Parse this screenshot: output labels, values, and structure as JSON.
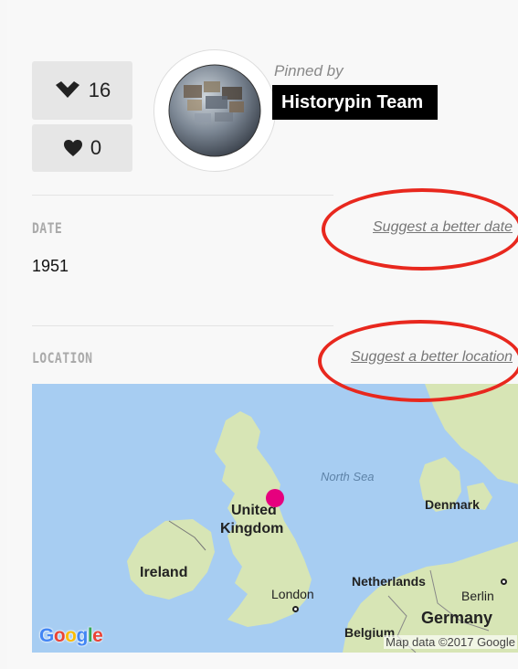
{
  "stats": {
    "likes": "16",
    "dislikes": "0"
  },
  "pin": {
    "pinned_by_label": "Pinned by",
    "owner": "Historypin Team"
  },
  "date_section": {
    "label": "DATE",
    "suggest_link": "Suggest a better date",
    "value": "1951"
  },
  "location_section": {
    "label": "LOCATION",
    "suggest_link": "Suggest a better location"
  },
  "map": {
    "labels": {
      "north_sea": "North Sea",
      "uk_line1": "United",
      "uk_line2": "Kingdom",
      "ireland": "Ireland",
      "london": "London",
      "netherlands": "Netherlands",
      "denmark": "Denmark",
      "berlin": "Berlin",
      "germany": "Germany",
      "belgium": "Belgium"
    },
    "logo": [
      "G",
      "o",
      "o",
      "g",
      "l",
      "e"
    ],
    "credit": "Map data ©2017 Google"
  },
  "colors": {
    "annotation": "#e8281e",
    "pin": "#e6007e",
    "water": "#a7cdf2",
    "land": "#d7e5b5"
  }
}
